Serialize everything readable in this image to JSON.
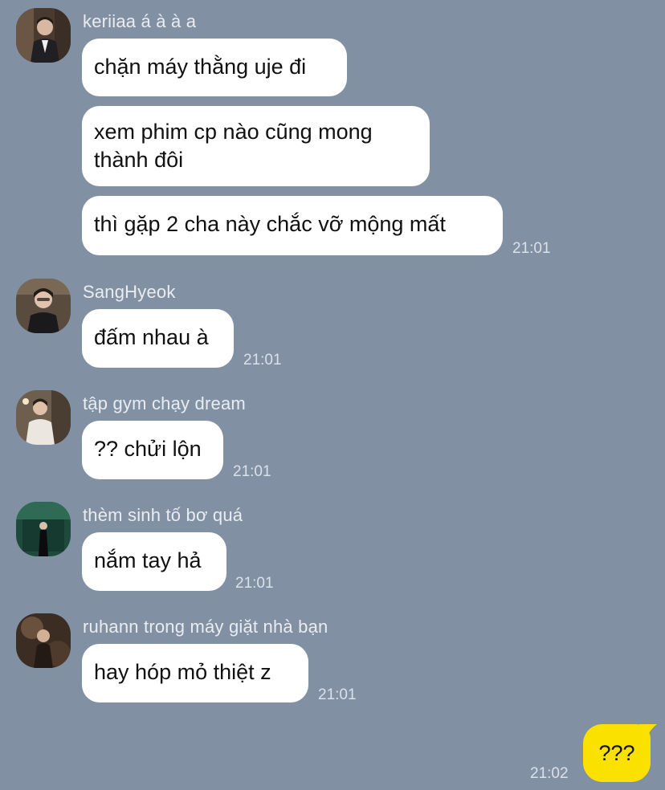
{
  "messages": [
    {
      "sender": "keriiaa á à à a",
      "bubbles": [
        "chặn máy thằng uje đi",
        "xem phim cp nào cũng mong thành đôi",
        "thì gặp 2 cha này chắc vỡ mộng mất"
      ],
      "time": "21:01"
    },
    {
      "sender": "SangHyeok",
      "bubbles": [
        "đấm nhau à"
      ],
      "time": "21:01"
    },
    {
      "sender": "tập gym chạy dream",
      "bubbles": [
        "?? chửi lộn"
      ],
      "time": "21:01"
    },
    {
      "sender": "thèm sinh tố bơ quá",
      "bubbles": [
        "nắm tay hả"
      ],
      "time": "21:01"
    },
    {
      "sender": "ruhann trong máy giặt nhà bạn",
      "bubbles": [
        "hay hóp mỏ thiệt z"
      ],
      "time": "21:01"
    }
  ],
  "my_message": {
    "text": "???",
    "time": "21:02"
  },
  "colors": {
    "background": "#8290a3",
    "incoming_bubble": "#ffffff",
    "outgoing_bubble": "#fae100"
  }
}
